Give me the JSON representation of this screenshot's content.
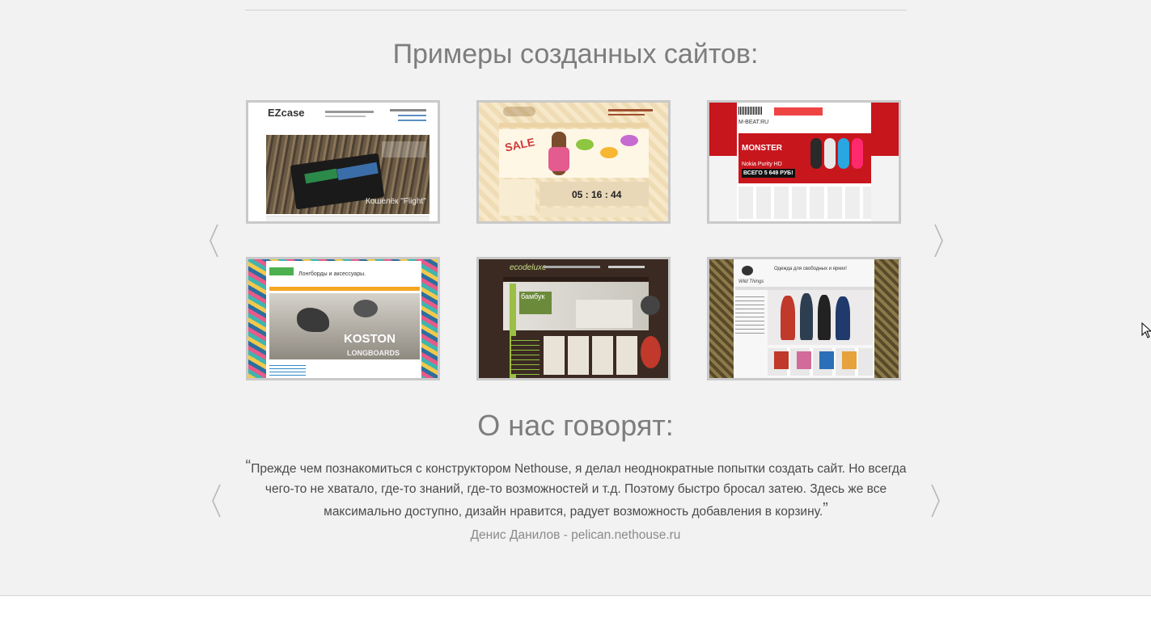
{
  "sections": {
    "examples_title": "Примеры созданных сайтов:",
    "reviews_title": "О нас говорят:"
  },
  "examples": [
    {
      "name": "ezcase",
      "logo": "EZcase",
      "banner": "Кошелёк \"Flight\""
    },
    {
      "name": "sale-shop",
      "logo": "",
      "banner": "SALE",
      "timer": "05 : 16 : 44"
    },
    {
      "name": "m-beat",
      "logo": "M-BEAT.RU",
      "banner": "MONSTER",
      "subtitle": "Nokia Purity HD",
      "price": "ВСЕГО 5 649 РУБ!"
    },
    {
      "name": "koston",
      "logo": "Лонгборды и аксессуары.",
      "banner": "KOSTON",
      "subtitle": "LONGBOARDS"
    },
    {
      "name": "ecodeluxe",
      "logo": "ecodeluxe",
      "banner": "бамбук"
    },
    {
      "name": "wild-things",
      "logo": "Wild Things",
      "banner": "Одежда для свободных и ярких!"
    }
  ],
  "review": {
    "open_quote": "“",
    "text": "Прежде чем познакомиться с конструктором Nethouse, я делал неоднократные попытки создать сайт. Но всегда чего-то не хватало, где-то знаний, где-то возможностей и т.д. Поэтому быстро бросал затею. Здесь же все максимально доступно, дизайн нравится, радует возможность добавления в корзину.",
    "close_quote": "”",
    "author": "Денис Данилов - pelican.nethouse.ru"
  },
  "icons": {
    "prev": "chevron-left-icon",
    "next": "chevron-right-icon"
  },
  "colors": {
    "background": "#f2f2f2",
    "title": "#7d7d7d",
    "thumb_border": "#c9c9c9",
    "text": "#4a4a4a"
  }
}
